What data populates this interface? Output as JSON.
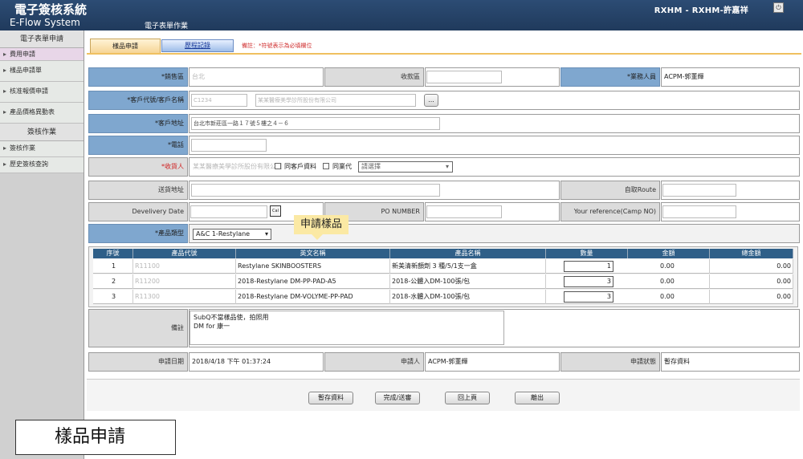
{
  "header": {
    "title": "電子簽核系統",
    "subtitle": "E-Flow System",
    "menu": "電子表單作業",
    "user": "RXHM - RXHM-許嘉祥"
  },
  "sidebar": {
    "section1": "電子表單申請",
    "items1": [
      "費用申請",
      "樣品申請單",
      "核准報價申請",
      "產品價格異動表"
    ],
    "section2": "簽核作業",
    "items2": [
      "簽核作業",
      "歷史簽核查詢"
    ]
  },
  "caption": "樣品申請",
  "tabs": {
    "tab1": "樣品申請",
    "tab2": "歷程記錄",
    "note": "備註：*符號表示為必填欄位"
  },
  "form": {
    "office_label": "*銷售區",
    "office_value": "台北",
    "receiver_area_label": "收款區",
    "sales_label": "*業務人員",
    "sales_value": "ACPM-郭董輝",
    "customer_label": "*客戶代號/客戶名稱",
    "customer_code": "C1234",
    "customer_name": "某某醫療美學診所股份有限公司",
    "browse_button": "...",
    "address_label": "*客戶地址",
    "address_value": "台北市新莊區一路１７號５樓之４－６",
    "phone_label": "*電話",
    "consignee_label": "*收貨人",
    "consignee_value": "某某醫療美學診所股份有限公司",
    "same_customer_label": "同客戶資料",
    "same_dealer_label": "同業代",
    "select_placeholder": "請選擇",
    "ship_address_label": "送貨地址",
    "self_pickup_label": "自取Route",
    "delivery_date_label": "Develivery Date",
    "cal_label": "Cal",
    "po_label": "PO NUMBER",
    "your_ref_label": "Your reference(Camp NO)",
    "product_line_label": "*產品類型",
    "product_line_value": "A&C 1-Restylane",
    "remark_label": "備註",
    "remark_value": "SubQ不當樣品使，拍照用\nDM for 康一",
    "apply_date_label": "申請日期",
    "apply_date_value": "2018/4/18 下午 01:37:24",
    "applicant_label": "申請人",
    "applicant_value": "ACPM-郭董輝",
    "status_label": "申請狀態",
    "status_value": "暫存資料"
  },
  "callout": "申請樣品",
  "table": {
    "headers": [
      "序號",
      "產品代號",
      "英文名稱",
      "產品名稱",
      "數量",
      "金額",
      "總金額"
    ],
    "rows": [
      {
        "no": "1",
        "code": "R11100",
        "en": "Restylane SKINBOOSTERS",
        "name": "新美清新顏劑 3 種/5/1支一盒",
        "qty": "1",
        "amt": "0.00",
        "total": "0.00"
      },
      {
        "no": "2",
        "code": "R11200",
        "en": "2018-Restylane DM-PP-PAD-A5",
        "name": "2018-公體入DM-100張/包",
        "qty": "3",
        "amt": "0.00",
        "total": "0.00"
      },
      {
        "no": "3",
        "code": "R11300",
        "en": "2018-Restylane DM-VOLYME-PP-PAD",
        "name": "2018-水體入DM-100張/包",
        "qty": "3",
        "amt": "0.00",
        "total": "0.00"
      }
    ]
  },
  "buttons": {
    "save": "暫存資料",
    "submit": "完成/送審",
    "back": "回上頁",
    "exit": "離出"
  }
}
